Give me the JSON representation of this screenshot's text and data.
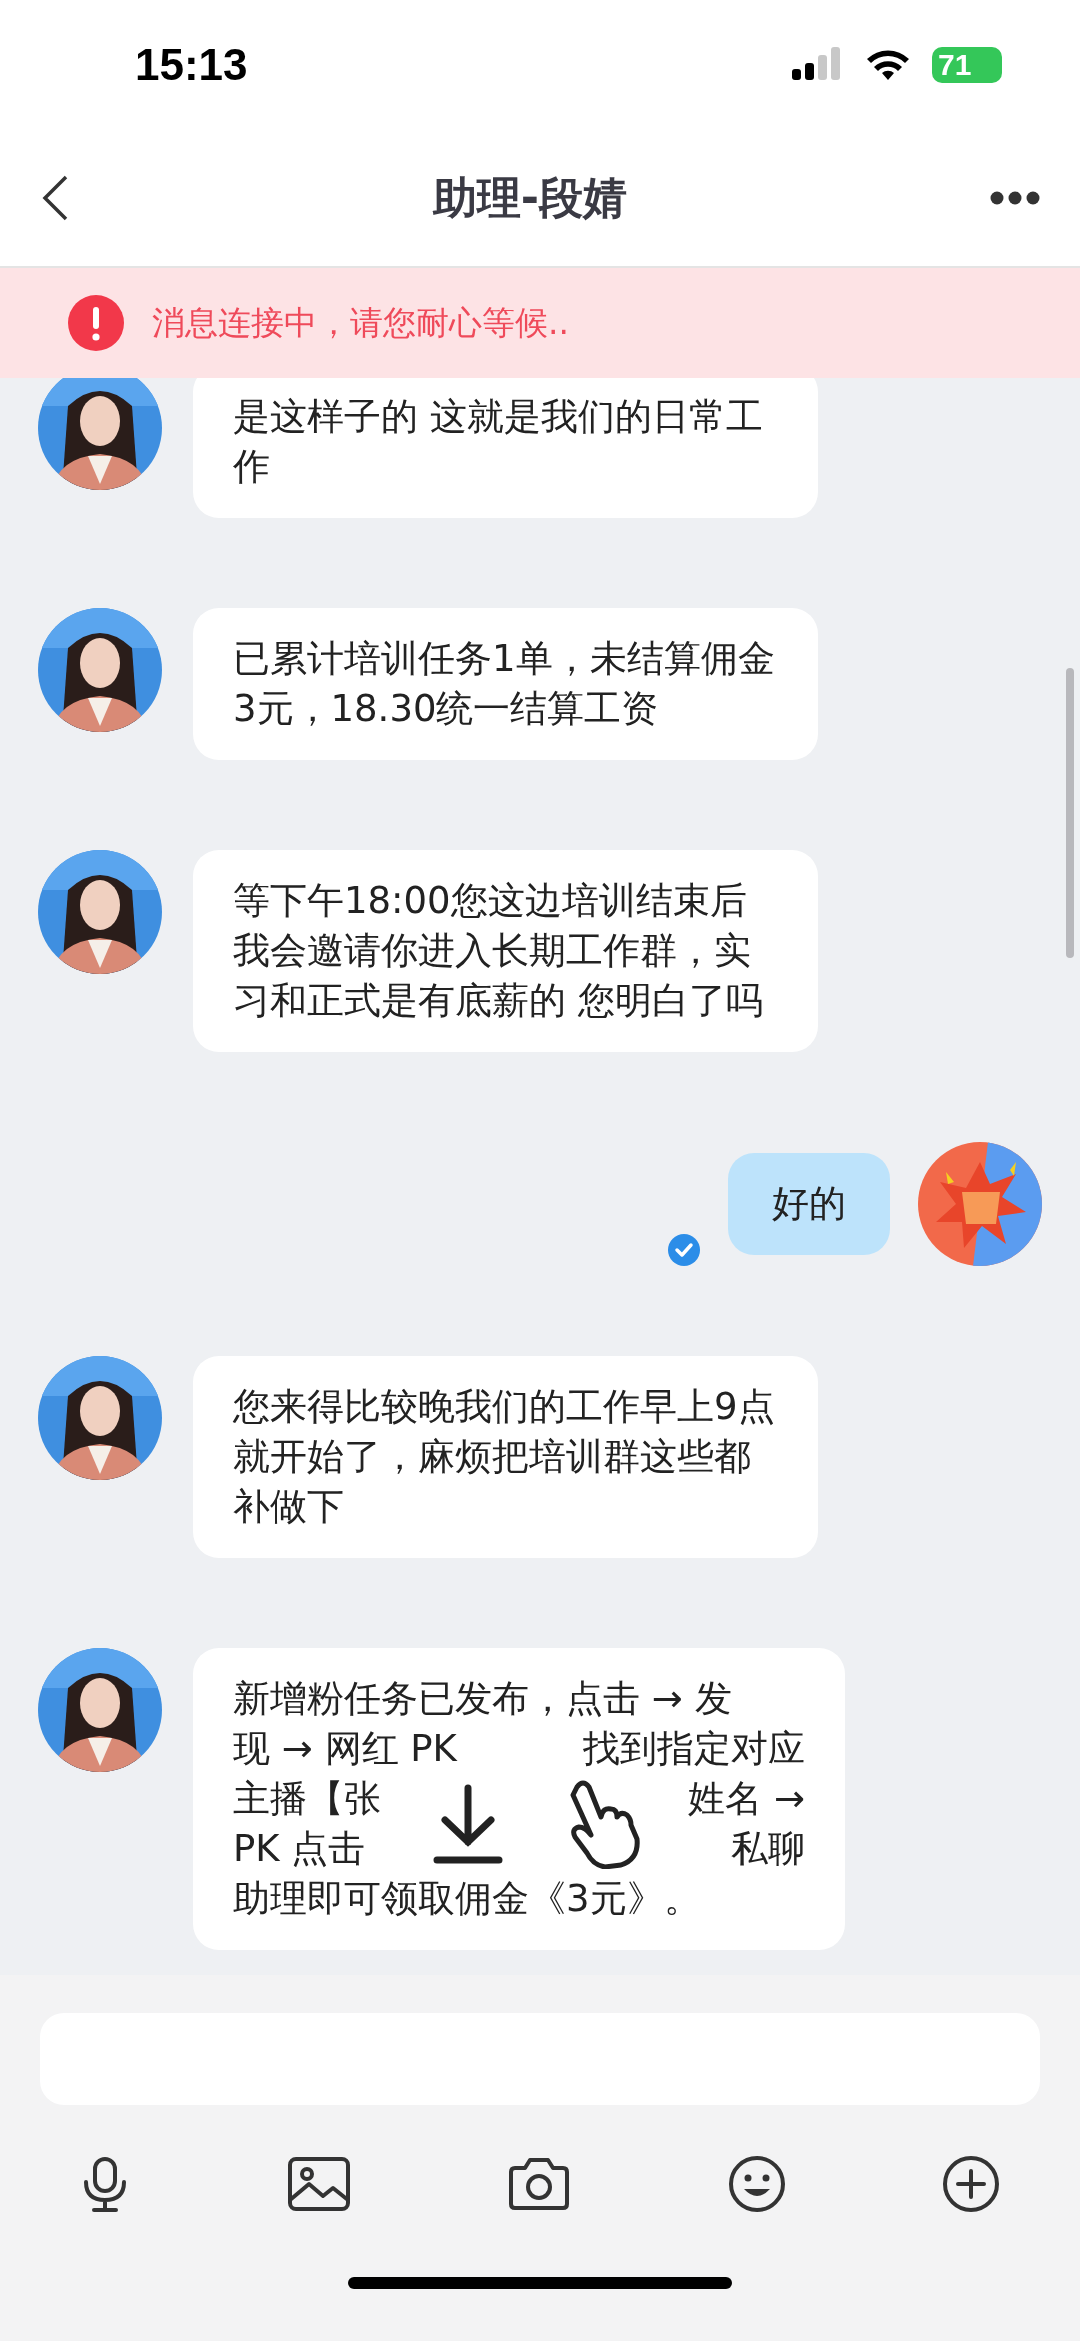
{
  "status_bar": {
    "time": "15:13",
    "battery": "71"
  },
  "nav": {
    "title": "助理-段婧"
  },
  "banner": {
    "text": "消息连接中，请您耐心等候.."
  },
  "messages": [
    {
      "kind": "received",
      "text": "是这样子的  这就是我们的日常工作"
    },
    {
      "kind": "received",
      "text": "已累计培训任务1单，未结算佣金3元，18.30统一结算工资"
    },
    {
      "kind": "received",
      "text": "等下午18:00您这边培训结束后我会邀请你进入长期工作群，实习和正式是有底薪的  您明白了吗"
    },
    {
      "kind": "sent",
      "text": "好的",
      "read": true
    },
    {
      "kind": "received",
      "text": "您来得比较晚我们的工作早上9点就开始了，麻烦把培训群这些都补做下"
    },
    {
      "kind": "received",
      "lines": [
        [
          "新增粉任务已发布，点击 → 发"
        ],
        [
          "现 → 网红 PK",
          "找到指定对应"
        ],
        [
          "主播【张",
          "姓名 →"
        ],
        [
          "PK  点击",
          "私聊"
        ],
        [
          "助理即可领取佣金《3元》。"
        ]
      ]
    }
  ]
}
